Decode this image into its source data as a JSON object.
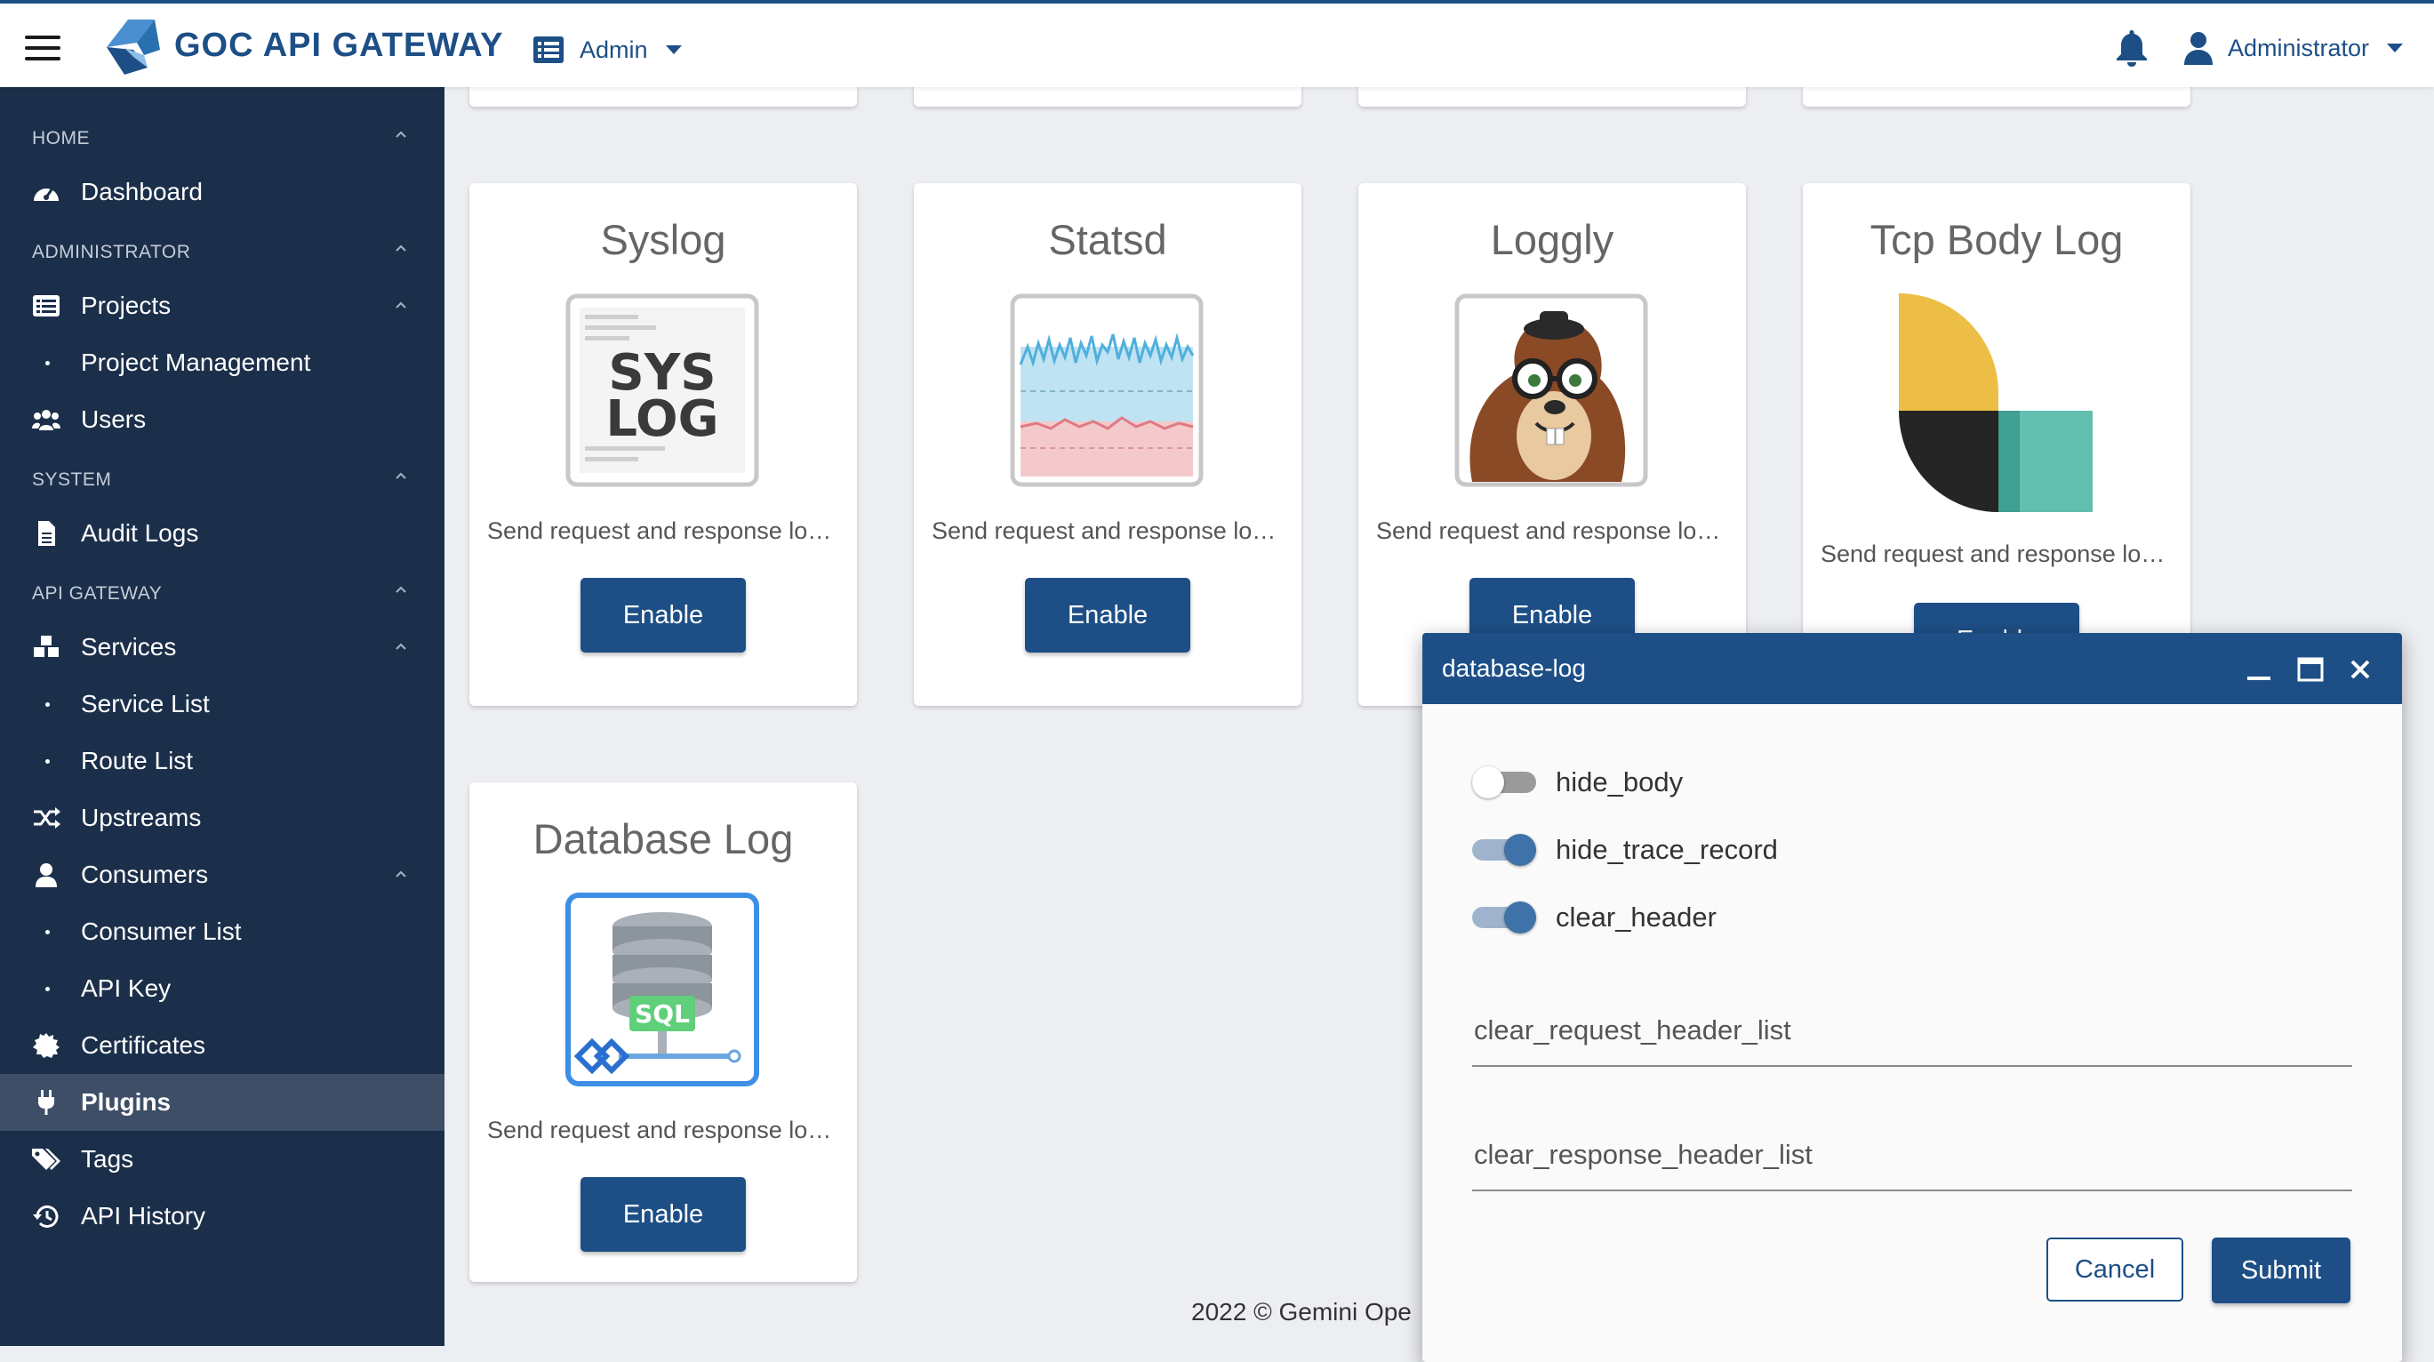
{
  "header": {
    "brand": "GOC API GATEWAY",
    "project_switcher": "Admin",
    "user": "Administrator",
    "icons": [
      "menu-icon",
      "logo-icon",
      "list-icon",
      "bell-icon",
      "user-icon"
    ]
  },
  "sidebar": {
    "sections": {
      "home": "HOME",
      "administrator": "ADMINISTRATOR",
      "system": "SYSTEM",
      "api_gateway": "API GATEWAY"
    },
    "items": {
      "dashboard": "Dashboard",
      "projects": "Projects",
      "project_management": "Project Management",
      "users": "Users",
      "audit_logs": "Audit Logs",
      "services": "Services",
      "service_list": "Service List",
      "route_list": "Route List",
      "upstreams": "Upstreams",
      "consumers": "Consumers",
      "consumer_list": "Consumer List",
      "api_key": "API Key",
      "certificates": "Certificates",
      "plugins": "Plugins",
      "tags": "Tags",
      "api_history": "API History"
    },
    "active": "Plugins"
  },
  "plugins": [
    {
      "title": "Syslog",
      "desc": "Send request and response logs to syslog",
      "button": "Enable"
    },
    {
      "title": "Statsd",
      "desc": "Send request and response logs to statsd",
      "button": "Enable"
    },
    {
      "title": "Loggly",
      "desc": "Send request and response logs to loggly",
      "button": "Enable"
    },
    {
      "title": "Tcp Body Log",
      "desc": "Send request and response logs to tcp",
      "button": "Enable"
    },
    {
      "title": "Database Log",
      "desc": "Send request and response logs to database",
      "button": "Enable"
    }
  ],
  "image_labels": {
    "syslog": [
      "SYS",
      "LOG"
    ],
    "sql": "SQL"
  },
  "footer": "2022 © Gemini Ope",
  "dialog": {
    "title": "database-log",
    "toggles": [
      {
        "label": "hide_body",
        "on": false
      },
      {
        "label": "hide_trace_record",
        "on": true
      },
      {
        "label": "clear_header",
        "on": true
      }
    ],
    "fields": [
      {
        "placeholder": "clear_request_header_list",
        "value": ""
      },
      {
        "placeholder": "clear_response_header_list",
        "value": ""
      }
    ],
    "cancel": "Cancel",
    "submit": "Submit"
  },
  "colors": {
    "primary": "#1d4f86",
    "sidebar": "#1b2f4a",
    "sidebar_active": "#3d4e66",
    "toggle_on_track": "#9fb4cc",
    "toggle_on_knob": "#3f72a8",
    "toggle_off_track": "#9a9a9a",
    "toggle_off_knob": "#ffffff"
  }
}
